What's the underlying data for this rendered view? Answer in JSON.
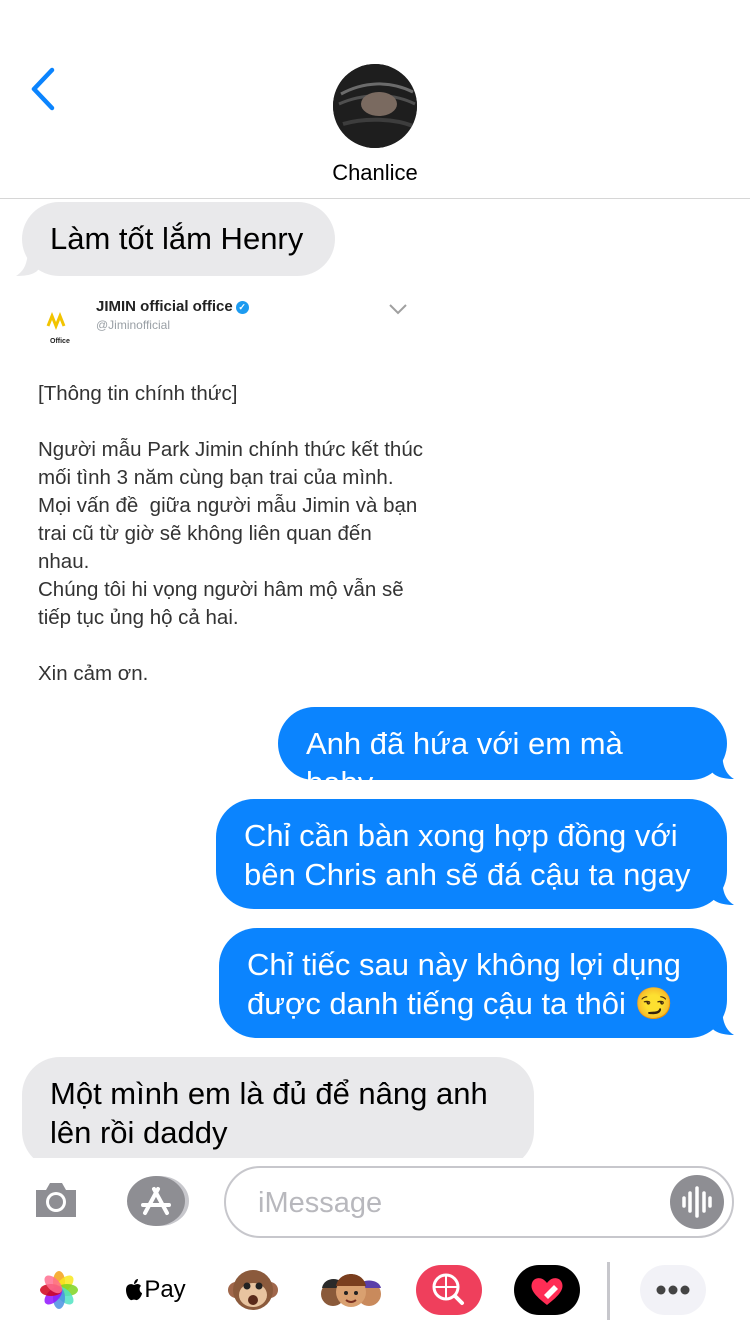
{
  "header": {
    "contact_name": "Chanlice"
  },
  "messages": {
    "m1": "Làm tốt lắm Henry",
    "m3": "Anh đã hứa với em mà baby",
    "m4": "Chỉ cần bàn xong hợp đồng với bên Chris anh sẽ đá cậu ta ngay",
    "m5": "Chỉ tiếc sau này không lợi dụng được danh tiếng cậu ta thôi 😏",
    "m6": "Một mình em là đủ để nâng anh lên rồi daddy"
  },
  "tweet": {
    "account_name": "JIMIN official office",
    "handle": "@Jiminofficial",
    "logo_text": "Office",
    "body": "[Thông tin chính thức]\n\nNgười mẫu Park Jimin chính thức kết thúc mối tình 3 năm cùng bạn trai của mình. Mọi vấn đề  giữa người mẫu Jimin và bạn trai cũ từ giờ sẽ không liên quan đến nhau.\nChúng tôi hi vọng người hâm mộ vẫn sẽ tiếp tục ủng hộ cả hai.\n\nXin cảm ơn."
  },
  "compose": {
    "placeholder": "iMessage"
  },
  "app_tray": {
    "apple_pay_label": "Pay"
  },
  "colors": {
    "accent": "#0b84fe",
    "incoming_bubble": "#e9e9eb",
    "battery": "#f7c300"
  }
}
